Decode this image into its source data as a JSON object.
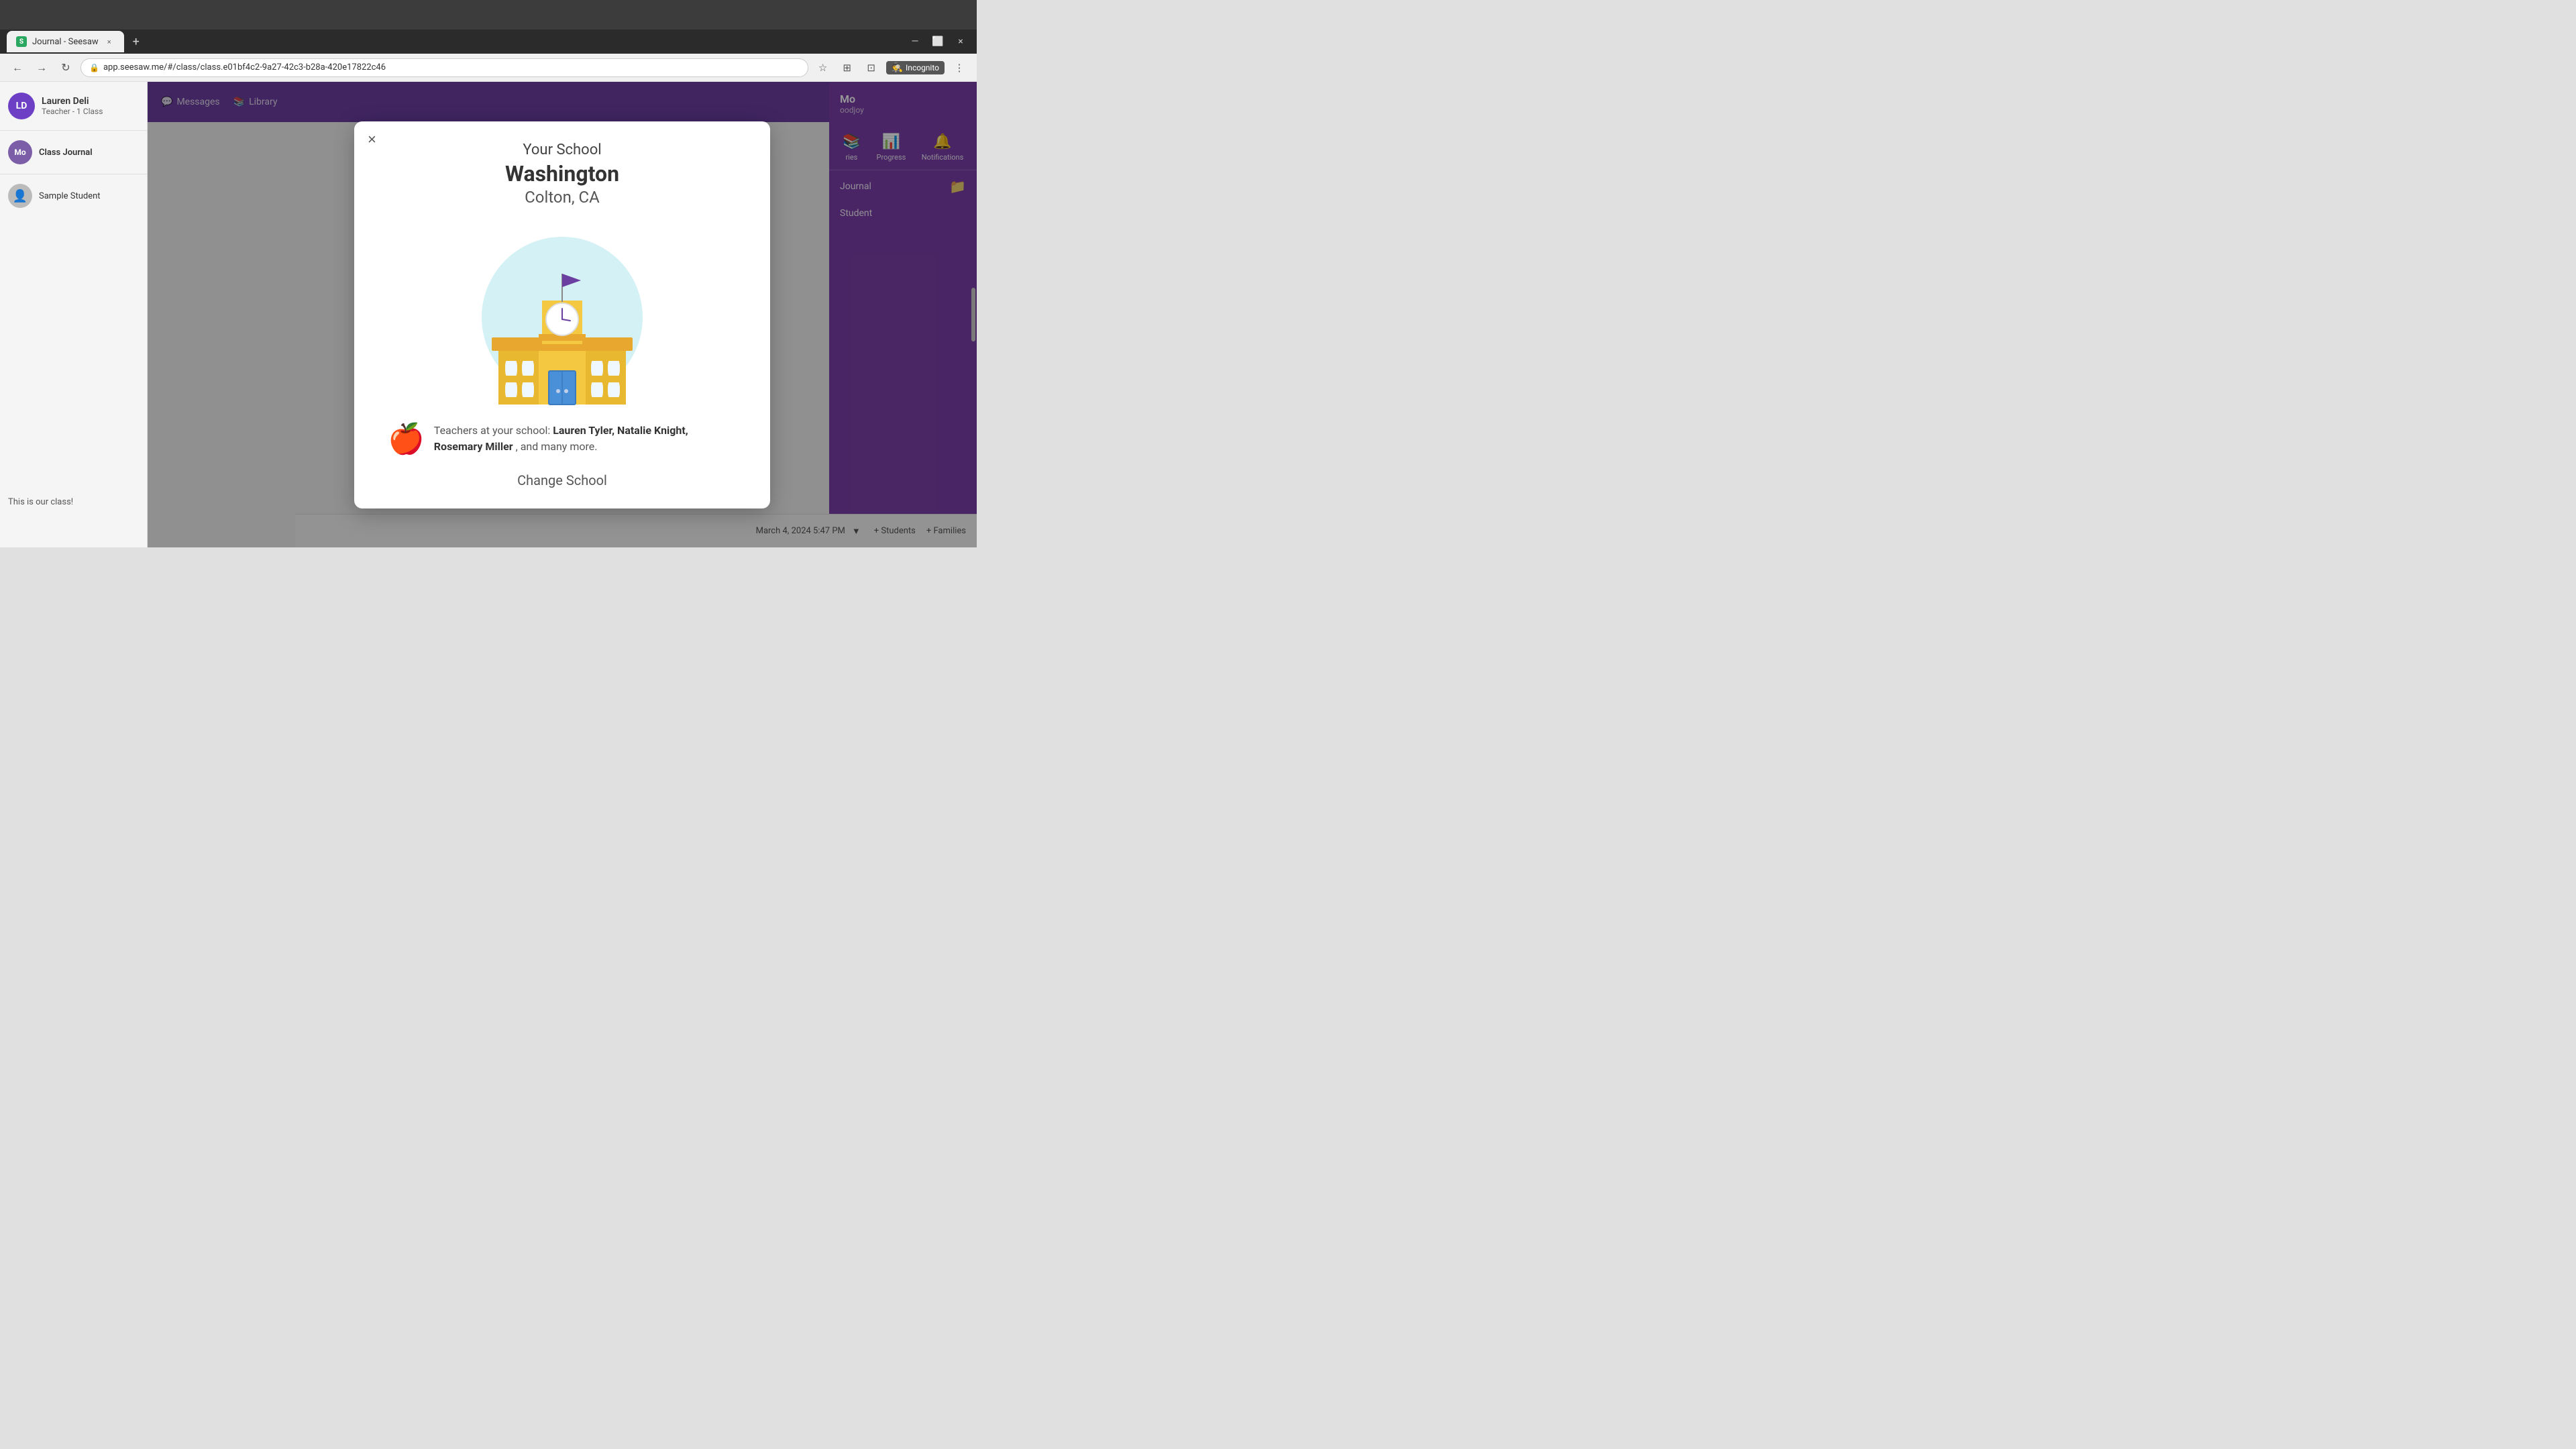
{
  "browser": {
    "tab": {
      "icon": "S",
      "title": "Journal - Seesaw",
      "close": "×"
    },
    "new_tab": "+",
    "nav": {
      "back": "←",
      "forward": "→",
      "refresh": "↻",
      "address": "app.seesaw.me/#/class/class.e01bf4c2-9a27-42c3-b28a-420e17822c46",
      "star": "☆",
      "extensions": "⊞",
      "layout": "⊡",
      "incognito": "Incognito",
      "menu": "⋮",
      "minimize": "—",
      "maximize": "⬜",
      "close": "×"
    }
  },
  "sidebar": {
    "user": {
      "initials": "LD",
      "name": "Lauren Deli",
      "role": "Teacher - 1 Class"
    },
    "class": {
      "initials": "Mo",
      "name": "Class Journal"
    },
    "student": {
      "name": "Sample Student"
    }
  },
  "right_panel": {
    "avatar_text": "Mo",
    "name": "Mo",
    "sub_name": "oodjoy",
    "nav_items": [
      {
        "icon": "📚",
        "label": "ries"
      },
      {
        "icon": "📊",
        "label": "Progress"
      },
      {
        "icon": "🔔",
        "label": "Notifications"
      }
    ],
    "section_label": "Journal",
    "folder_icon": "📁",
    "student_label": "Student"
  },
  "bottom_bar": {
    "class_intro": "This is our class!",
    "date": "March 4, 2024 5:47 PM",
    "students_btn": "+ Students",
    "families_btn": "+ Families"
  },
  "modal": {
    "close": "×",
    "title": "Your School",
    "school_name": "Washington",
    "location": "Colton, CA",
    "teachers_label": "Teachers at your school:",
    "teachers": "Lauren Tyler, Natalie Knight, Rosemary Miller",
    "teachers_more": ", and many more.",
    "change_school": "Change School"
  }
}
